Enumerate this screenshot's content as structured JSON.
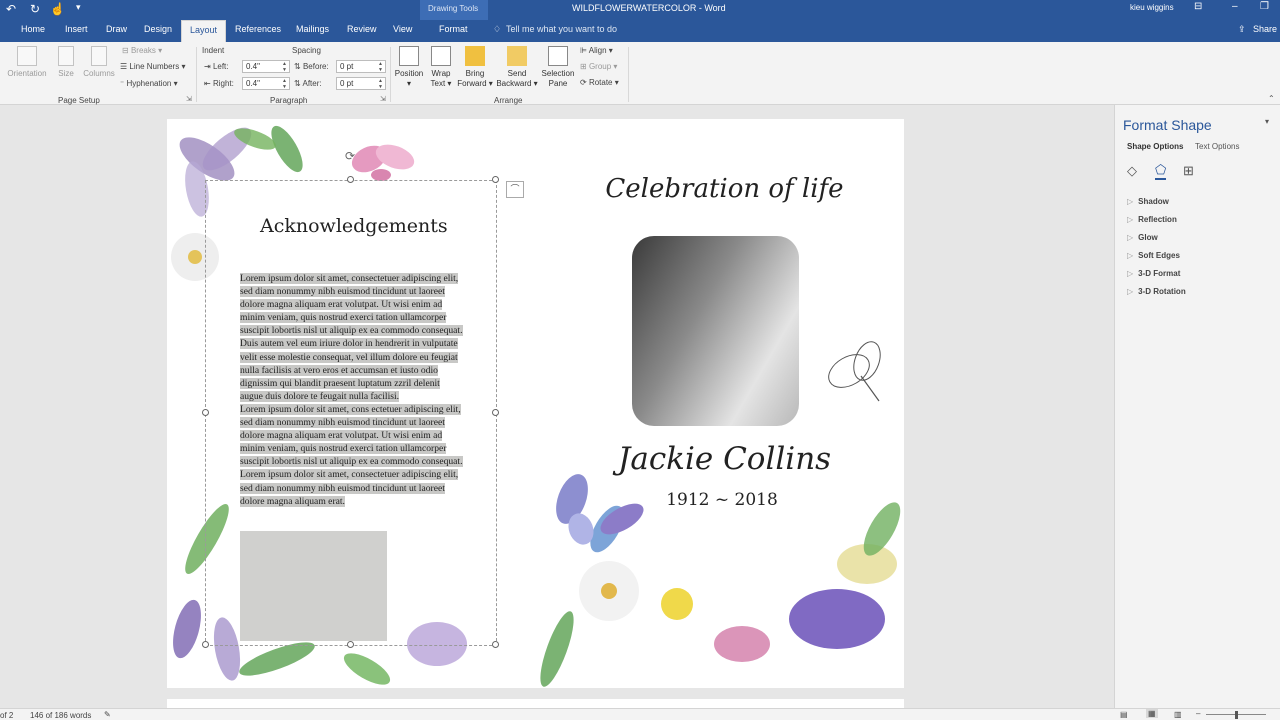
{
  "title": {
    "context_label": "Drawing Tools",
    "doc_title": "WILDFLOWERWATERCOLOR - Word",
    "user": "kieu wiggins"
  },
  "tabs": [
    "Home",
    "Insert",
    "Draw",
    "Design",
    "Layout",
    "References",
    "Mailings",
    "Review",
    "View",
    "Format"
  ],
  "tell_me": "Tell me what you want to do",
  "share": "Share",
  "ribbon": {
    "page_setup": {
      "orientation": "Orientation",
      "size": "Size",
      "columns": "Columns",
      "breaks": "Breaks",
      "line_numbers": "Line Numbers",
      "hyphenation": "Hyphenation",
      "group": "Page Setup"
    },
    "paragraph": {
      "indent_label": "Indent",
      "spacing_label": "Spacing",
      "left_label": "Left:",
      "right_label": "Right:",
      "before_label": "Before:",
      "after_label": "After:",
      "left_value": "0.4\"",
      "right_value": "0.4\"",
      "before_value": "0 pt",
      "after_value": "0 pt",
      "group": "Paragraph"
    },
    "arrange": {
      "position": "Position",
      "wrap_1": "Wrap",
      "wrap_2": "Text",
      "bring_1": "Bring",
      "bring_2": "Forward",
      "send_1": "Send",
      "send_2": "Backward",
      "selection_1": "Selection",
      "selection_2": "Pane",
      "align": "Align",
      "group_btn": "Group",
      "rotate": "Rotate",
      "group": "Arrange"
    }
  },
  "document": {
    "heading": "Acknowledgements",
    "para1": "Lorem ipsum dolor sit amet, consectetuer adipiscing elit, sed diam nonummy nibh euismod tincidunt ut laoreet dolore magna aliquam erat volutpat. Ut wisi enim ad minim veniam, quis nostrud exerci tation ullamcorper suscipit lobortis nisl ut aliquip ex ea commodo consequat. Duis autem vel eum iriure dolor in hendrerit in vulputate velit esse molestie consequat, vel illum dolore eu feugiat nulla facilisis at vero eros et accumsan et iusto odio dignissim qui blandit praesent luptatum zzril delenit augue duis dolore te feugait nulla facilisi.",
    "para2": "Lorem ipsum dolor sit amet, cons ectetuer adipiscing elit, sed diam nonummy nibh euismod tincidunt ut laoreet dolore magna aliquam erat volutpat. Ut wisi enim ad minim veniam, quis nostrud exerci tation ullamcorper suscipit lobortis nisl ut aliquip ex ea commodo consequat.",
    "para3": "Lorem ipsum dolor sit amet, consectetuer adipiscing elit, sed diam nonummy nibh euismod tincidunt ut laoreet dolore magna aliquam erat.",
    "celebration": "Celebration of life",
    "name": "Jackie Collins",
    "years": "1912 ~ 2018"
  },
  "format_pane": {
    "title": "Format Shape",
    "tab_shape": "Shape Options",
    "tab_text": "Text Options",
    "sections": [
      "Shadow",
      "Reflection",
      "Glow",
      "Soft Edges",
      "3-D Format",
      "3-D Rotation"
    ]
  },
  "status": {
    "page": "of 2",
    "words": "146 of 186 words"
  },
  "colors": {
    "ribbon_blue": "#2b579a",
    "pane_title": "#2b579a"
  }
}
